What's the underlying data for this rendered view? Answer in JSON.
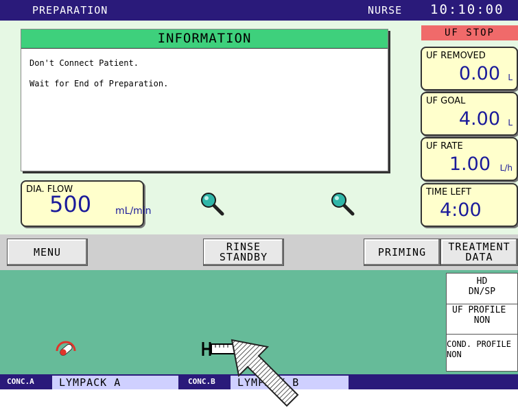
{
  "topbar": {
    "mode": "PREPARATION",
    "user": "NURSE",
    "time": "10:10:00"
  },
  "information": {
    "title": "INFORMATION",
    "lines": [
      "Don't Connect Patient.",
      "Wait for End of Preparation."
    ]
  },
  "uf_status": "UF  STOP",
  "params": {
    "uf_removed": {
      "label": "UF REMOVED",
      "value": "0.00",
      "unit": "L"
    },
    "uf_goal": {
      "label": "UF GOAL",
      "value": "4.00",
      "unit": "L"
    },
    "uf_rate": {
      "label": "UF RATE",
      "value": "1.00",
      "unit": "L/h"
    },
    "time_left": {
      "label": "TIME LEFT",
      "value": "4:00"
    },
    "dia_flow": {
      "label": "DIA. FLOW",
      "value": "500",
      "unit": "mL/min"
    }
  },
  "menu": {
    "menu": "MENU",
    "rinse_line1": "RINSE",
    "rinse_line2": "STANDBY",
    "priming": "PRIMING",
    "treatment_line1": "TREATMENT",
    "treatment_line2": "DATA"
  },
  "modes": {
    "hd_line1": "HD",
    "hd_line2": "DN/SP",
    "uf_profile_line1": "UF PROFILE",
    "uf_profile_line2": "NON",
    "cond_profile_line1": "COND. PROFILE",
    "cond_profile_line2": "NON"
  },
  "concentrate": {
    "a_label": "CONC.A",
    "a_value": "LYMPACK A",
    "b_label": "CONC.B",
    "b_value": "LYMPACK B"
  },
  "colors": {
    "topbar": "#2a1a7a",
    "info_header": "#3ed07c",
    "uf_stop": "#f06a6a",
    "param_bg": "#ffffcc",
    "lower_panel": "#66bb99"
  },
  "icons": [
    "magnifier-icon",
    "magnifier-icon",
    "pressure-gauge-icon",
    "syringe-icon",
    "pointer-arrow-icon"
  ]
}
